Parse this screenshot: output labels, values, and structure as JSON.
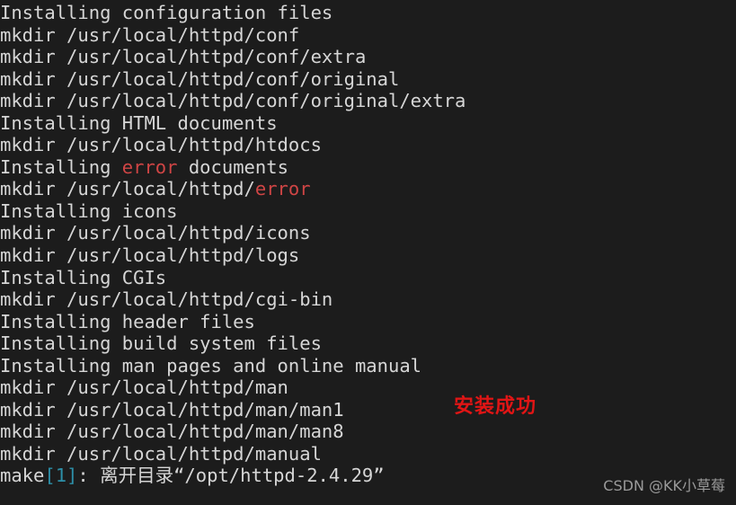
{
  "terminal": {
    "background_color": "#1c1c1c",
    "default_text_color": "#d6d6d6",
    "highlight_color": "#d04545",
    "accent_color": "#2d8fa8",
    "lines": [
      {
        "segments": [
          {
            "text": "Installing configuration files",
            "style": "plain"
          }
        ]
      },
      {
        "segments": [
          {
            "text": "mkdir /usr/local/httpd/conf",
            "style": "plain"
          }
        ]
      },
      {
        "segments": [
          {
            "text": "mkdir /usr/local/httpd/conf/extra",
            "style": "plain"
          }
        ]
      },
      {
        "segments": [
          {
            "text": "mkdir /usr/local/httpd/conf/original",
            "style": "plain"
          }
        ]
      },
      {
        "segments": [
          {
            "text": "mkdir /usr/local/httpd/conf/original/extra",
            "style": "plain"
          }
        ]
      },
      {
        "segments": [
          {
            "text": "Installing HTML documents",
            "style": "plain"
          }
        ]
      },
      {
        "segments": [
          {
            "text": "mkdir /usr/local/httpd/htdocs",
            "style": "plain"
          }
        ]
      },
      {
        "segments": [
          {
            "text": "Installing ",
            "style": "plain"
          },
          {
            "text": "error",
            "style": "red"
          },
          {
            "text": " documents",
            "style": "plain"
          }
        ]
      },
      {
        "segments": [
          {
            "text": "mkdir /usr/local/httpd/",
            "style": "plain"
          },
          {
            "text": "error",
            "style": "red"
          }
        ]
      },
      {
        "segments": [
          {
            "text": "Installing icons",
            "style": "plain"
          }
        ]
      },
      {
        "segments": [
          {
            "text": "mkdir /usr/local/httpd/icons",
            "style": "plain"
          }
        ]
      },
      {
        "segments": [
          {
            "text": "mkdir /usr/local/httpd/logs",
            "style": "plain"
          }
        ]
      },
      {
        "segments": [
          {
            "text": "Installing CGIs",
            "style": "plain"
          }
        ]
      },
      {
        "segments": [
          {
            "text": "mkdir /usr/local/httpd/cgi-bin",
            "style": "plain"
          }
        ]
      },
      {
        "segments": [
          {
            "text": "Installing header files",
            "style": "plain"
          }
        ]
      },
      {
        "segments": [
          {
            "text": "Installing build system files",
            "style": "plain"
          }
        ]
      },
      {
        "segments": [
          {
            "text": "Installing man pages and online manual",
            "style": "plain"
          }
        ]
      },
      {
        "segments": [
          {
            "text": "mkdir /usr/local/httpd/man",
            "style": "plain"
          }
        ]
      },
      {
        "segments": [
          {
            "text": "mkdir /usr/local/httpd/man/man1",
            "style": "plain"
          }
        ]
      },
      {
        "segments": [
          {
            "text": "mkdir /usr/local/httpd/man/man8",
            "style": "plain"
          }
        ]
      },
      {
        "segments": [
          {
            "text": "mkdir /usr/local/httpd/manual",
            "style": "plain"
          }
        ]
      },
      {
        "segments": [
          {
            "text": "make",
            "style": "plain"
          },
          {
            "text": "[1]",
            "style": "blue"
          },
          {
            "text": ": 离开目录“/opt/httpd-2.4.29”",
            "style": "plain"
          }
        ]
      }
    ]
  },
  "annotation": {
    "text": "安装成功",
    "color": "#e01515"
  },
  "watermark": {
    "text": "CSDN @KK小草莓",
    "color": "#9a9a9a"
  }
}
